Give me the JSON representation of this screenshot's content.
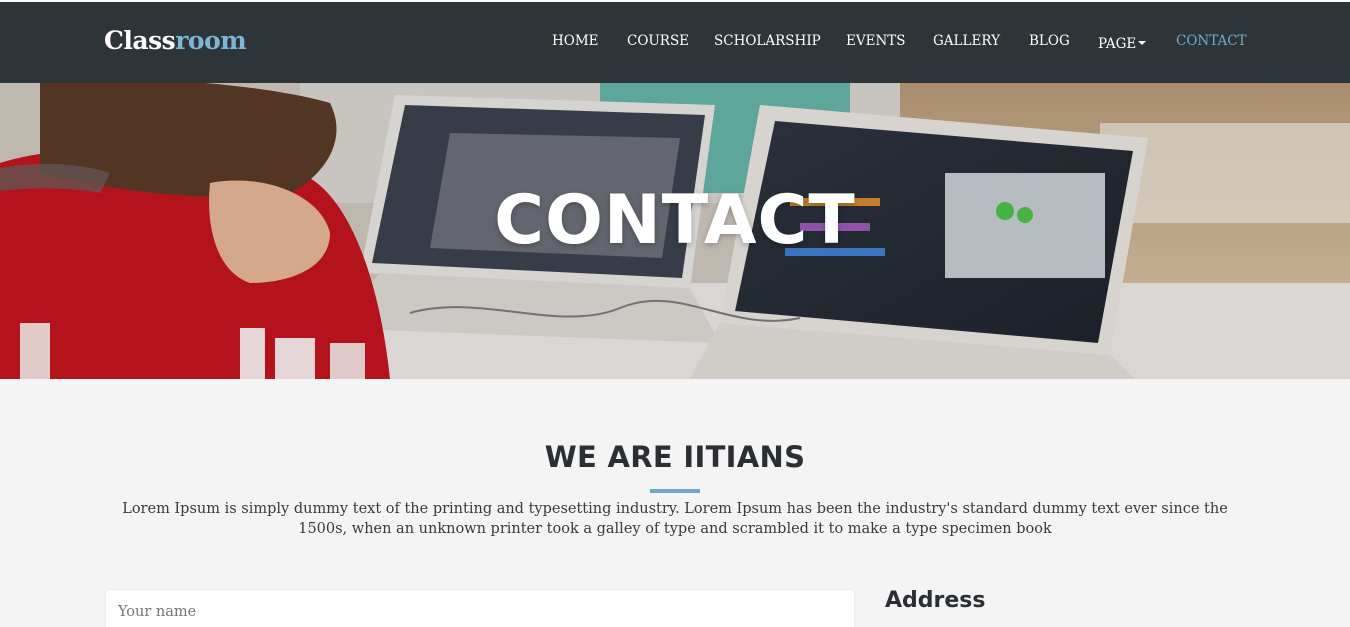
{
  "brand": {
    "part1": "Class",
    "part2": "room"
  },
  "nav": {
    "items": [
      {
        "label": "HOME"
      },
      {
        "label": "COURSE"
      },
      {
        "label": "SCHOLARSHIP"
      },
      {
        "label": "EVENTS"
      },
      {
        "label": "GALLERY"
      },
      {
        "label": "BLOG"
      },
      {
        "label": "PAGE"
      },
      {
        "label": "CONTACT",
        "active": true
      }
    ]
  },
  "hero": {
    "title": "CONTACT"
  },
  "intro": {
    "heading": "WE ARE IITIANS",
    "text": "Lorem Ipsum is simply dummy text of the printing and typesetting industry. Lorem Ipsum has been the industry's standard dummy text ever since the 1500s, when an unknown printer took a galley of type and scrambled it to make a type specimen book"
  },
  "form": {
    "name_placeholder": "Your name"
  },
  "address": {
    "heading": "Address"
  },
  "colors": {
    "navbar": "#2e3539",
    "accent": "#6fa8cc",
    "page_bg": "#f4f4f4"
  }
}
